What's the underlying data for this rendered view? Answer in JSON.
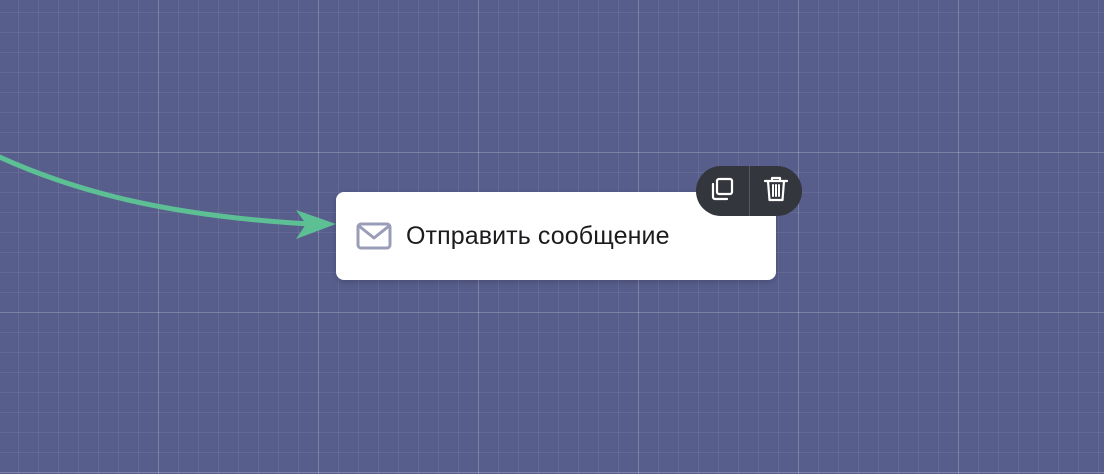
{
  "canvas": {
    "background_color": "#575e8b",
    "grid_color": "#ffffff"
  },
  "connector": {
    "color": "#5dbf94"
  },
  "node": {
    "icon": "mail-icon",
    "label": "Отправить сообщение"
  },
  "toolbar": {
    "background": "#34363d",
    "buttons": [
      {
        "icon": "copy-icon",
        "action": "duplicate"
      },
      {
        "icon": "trash-icon",
        "action": "delete"
      }
    ]
  }
}
